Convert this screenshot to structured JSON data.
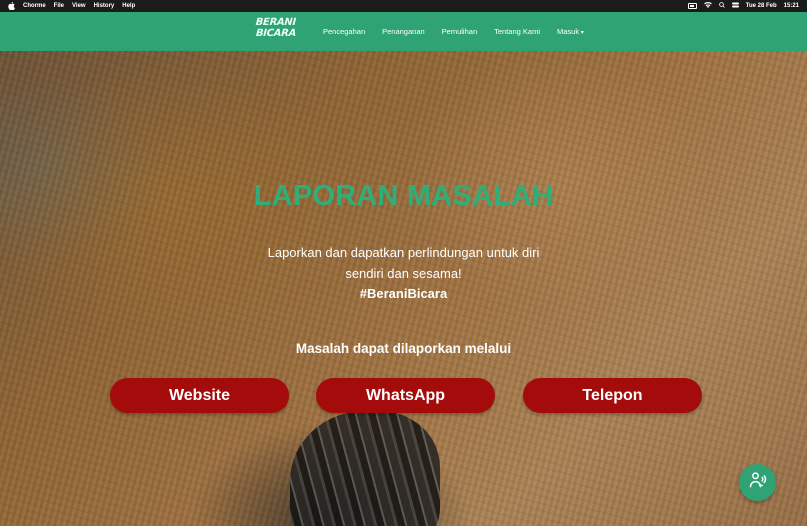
{
  "os_bar": {
    "app": "Chorme",
    "menus": [
      "File",
      "View",
      "History",
      "Help"
    ],
    "date": "Tue 28 Feb",
    "time": "15:21"
  },
  "navbar": {
    "logo_line1": "BERANI",
    "logo_line2": "BICARA",
    "links": [
      "Pencegahan",
      "Penanganan",
      "Pemulihan",
      "Tentang Kami"
    ],
    "dropdown_label": "Masuk"
  },
  "hero": {
    "title": "LAPORAN MASALAH",
    "subtitle_line1": "Laporkan dan dapatkan perlindungan untuk diri",
    "subtitle_line2": "sendiri dan sesama!",
    "hashtag": "#BeraniBicara",
    "channels_prompt": "Masalah dapat dilaporkan melalui",
    "buttons": [
      "Website",
      "WhatsApp",
      "Telepon"
    ]
  },
  "colors": {
    "brand_green": "#2fa374",
    "title_green": "#2fae7a",
    "button_red": "#a40b0b"
  },
  "icons": {
    "fab": "support-agent-icon"
  }
}
